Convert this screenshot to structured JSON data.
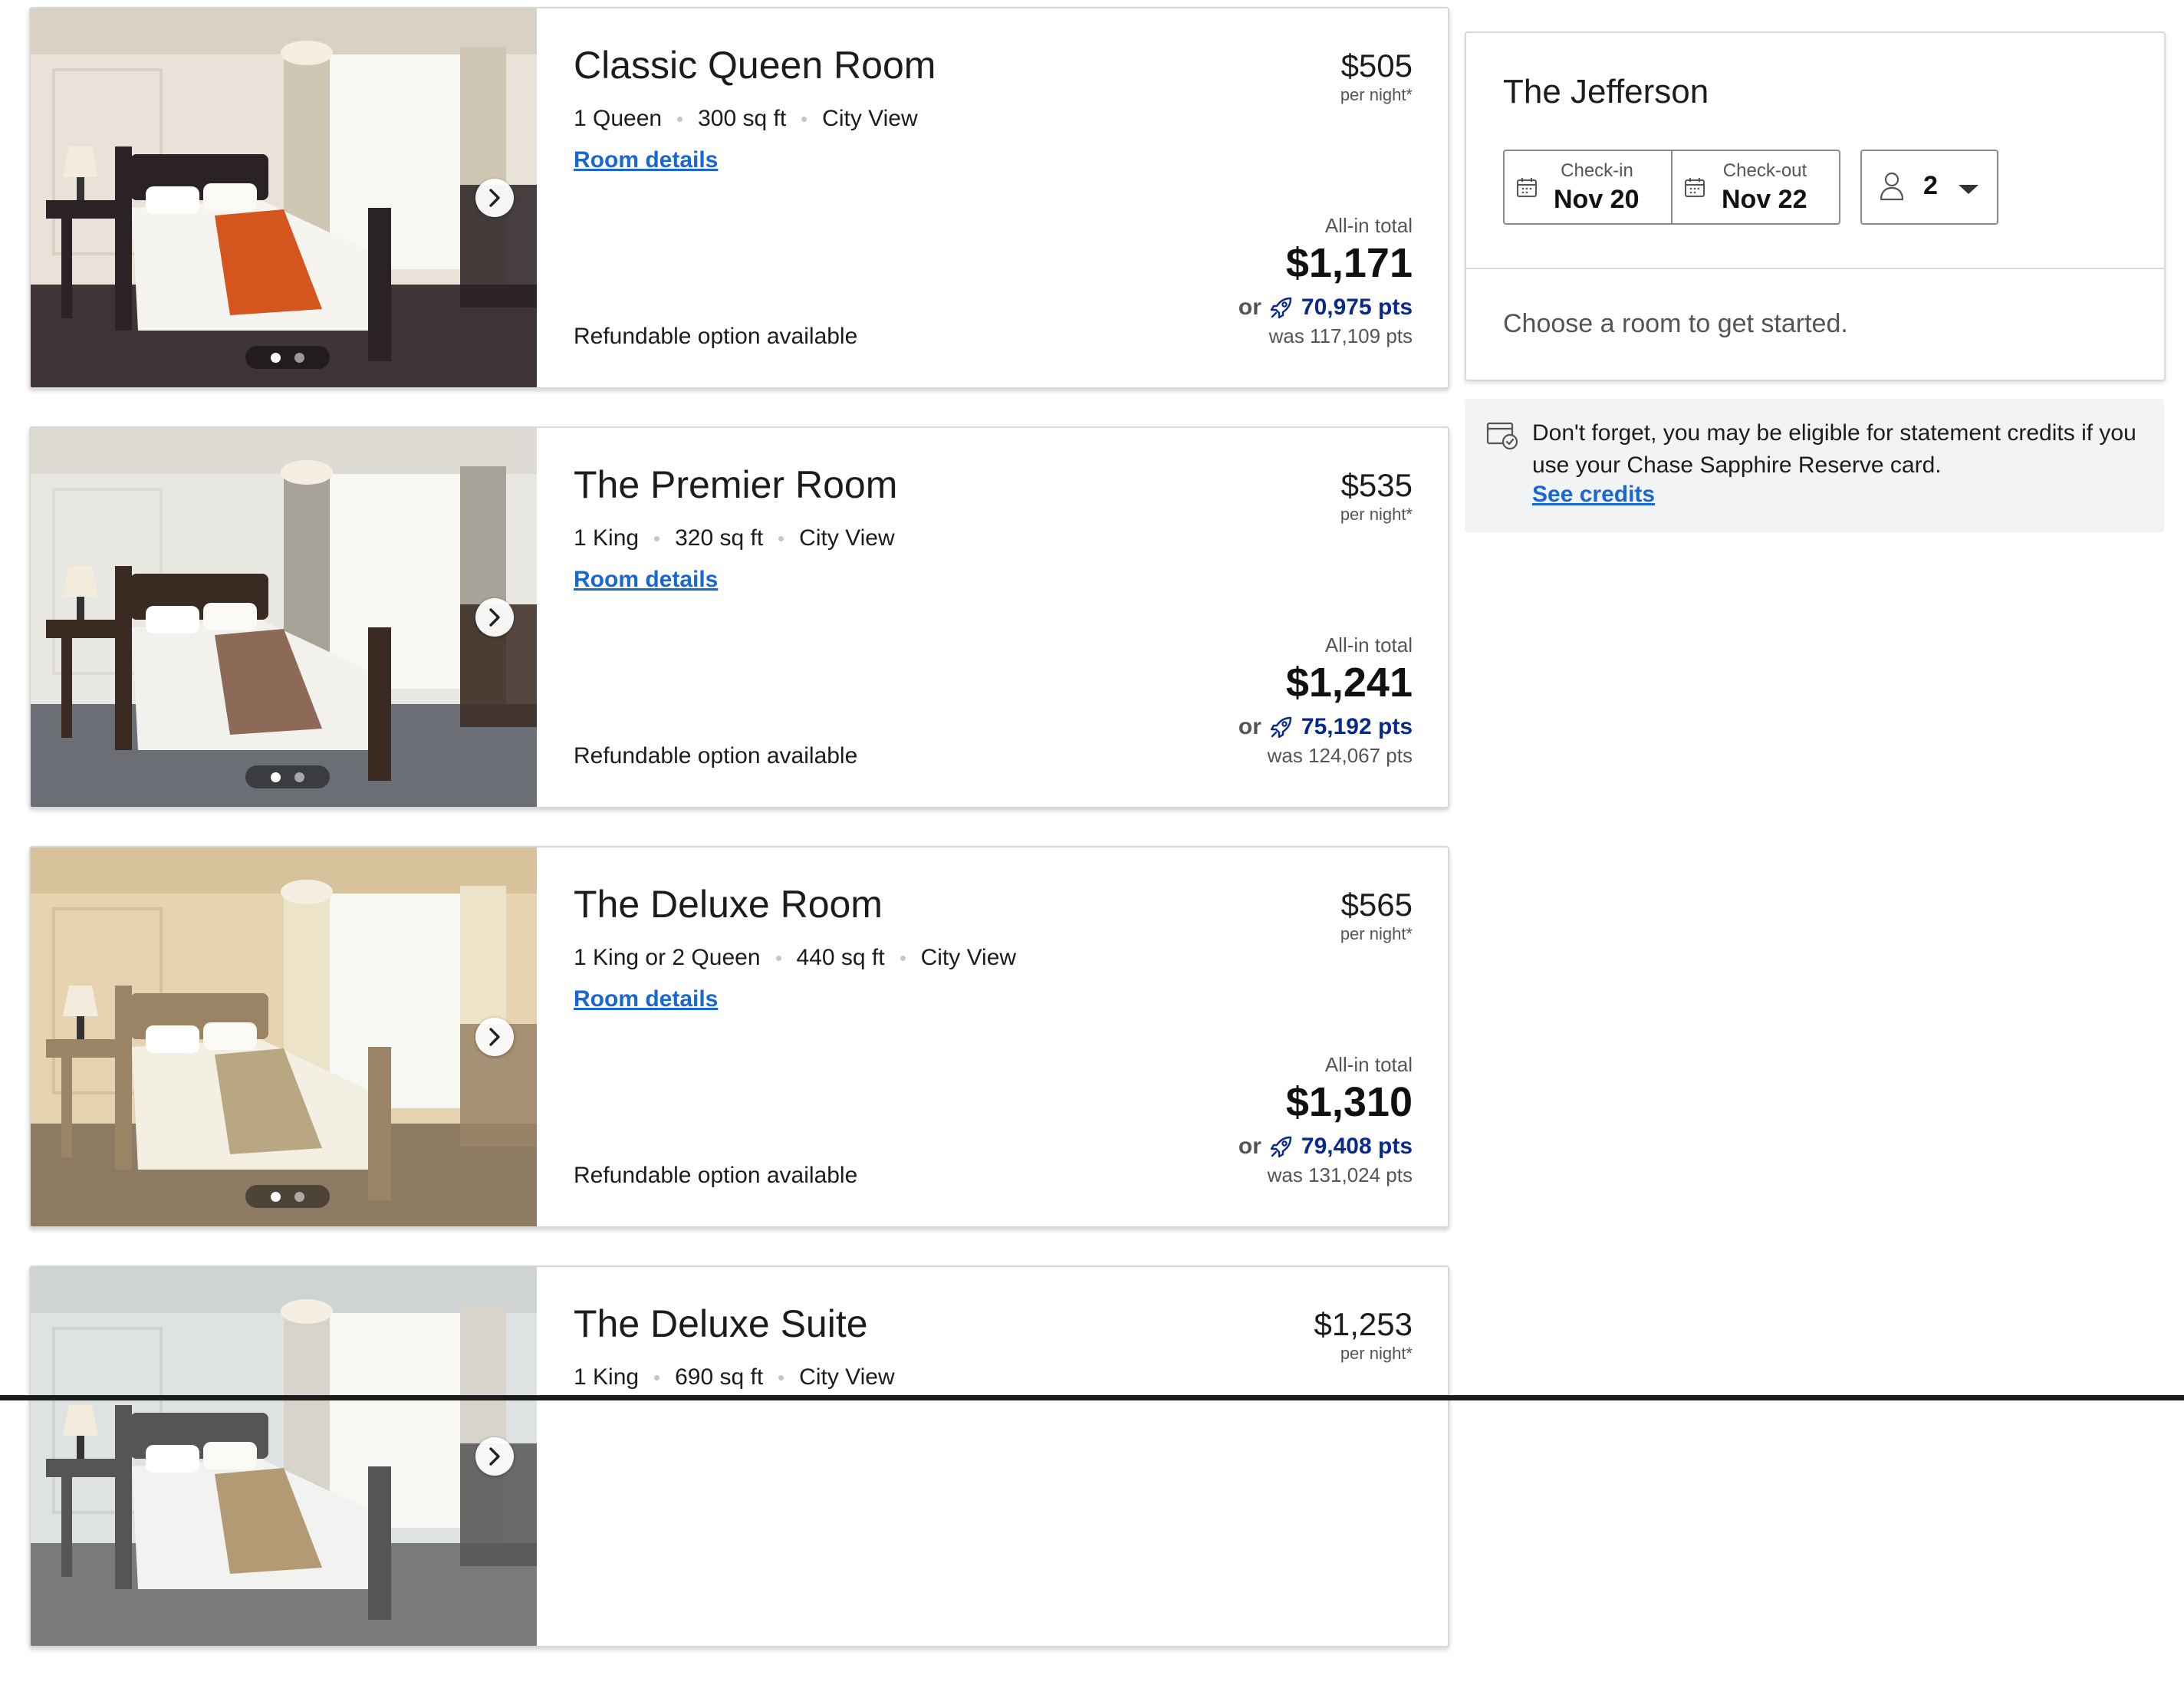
{
  "rooms": [
    {
      "name": "Classic Queen Room",
      "specs": [
        "1 Queen",
        "300 sq ft",
        "City View"
      ],
      "details_label": "Room details",
      "nightly_price": "$505",
      "per_night": "per night*",
      "total_label": "All-in total",
      "total": "$1,171",
      "or_label": "or",
      "points": "70,975 pts",
      "was_points": "was 117,109 pts",
      "refundable": "Refundable option available",
      "photo_dots": 2,
      "photo_active": 0
    },
    {
      "name": "The Premier Room",
      "specs": [
        "1 King",
        "320 sq ft",
        "City View"
      ],
      "details_label": "Room details",
      "nightly_price": "$535",
      "per_night": "per night*",
      "total_label": "All-in total",
      "total": "$1,241",
      "or_label": "or",
      "points": "75,192 pts",
      "was_points": "was 124,067 pts",
      "refundable": "Refundable option available",
      "photo_dots": 2,
      "photo_active": 0
    },
    {
      "name": "The Deluxe Room",
      "specs": [
        "1 King or 2 Queen",
        "440 sq ft",
        "City View"
      ],
      "details_label": "Room details",
      "nightly_price": "$565",
      "per_night": "per night*",
      "total_label": "All-in total",
      "total": "$1,310",
      "or_label": "or",
      "points": "79,408 pts",
      "was_points": "was 131,024 pts",
      "refundable": "Refundable option available",
      "photo_dots": 2,
      "photo_active": 0
    },
    {
      "name": "The Deluxe Suite",
      "specs": [
        "1 King",
        "690 sq ft",
        "City View"
      ],
      "nightly_price": "$1,253",
      "per_night": "per night*"
    }
  ],
  "booking": {
    "hotel_name": "The Jefferson",
    "checkin_label": "Check-in",
    "checkin_value": "Nov 20",
    "checkout_label": "Check-out",
    "checkout_value": "Nov 22",
    "guests": "2",
    "prompt": "Choose a room to get started."
  },
  "credits": {
    "text": "Don't forget, you may be eligible for statement credits if you use your Chase Sapphire Reserve card.",
    "link": "See credits"
  },
  "icons": {
    "photo_next": "chevron-right-icon",
    "rewards": "rocket-icon",
    "calendar": "calendar-icon",
    "guest": "person-icon",
    "dropdown": "caret-down-icon",
    "credits": "card-credit-icon"
  },
  "colors": {
    "link": "#1967d2",
    "points": "#0a2a8a",
    "note_bg": "#f2f3f5"
  }
}
